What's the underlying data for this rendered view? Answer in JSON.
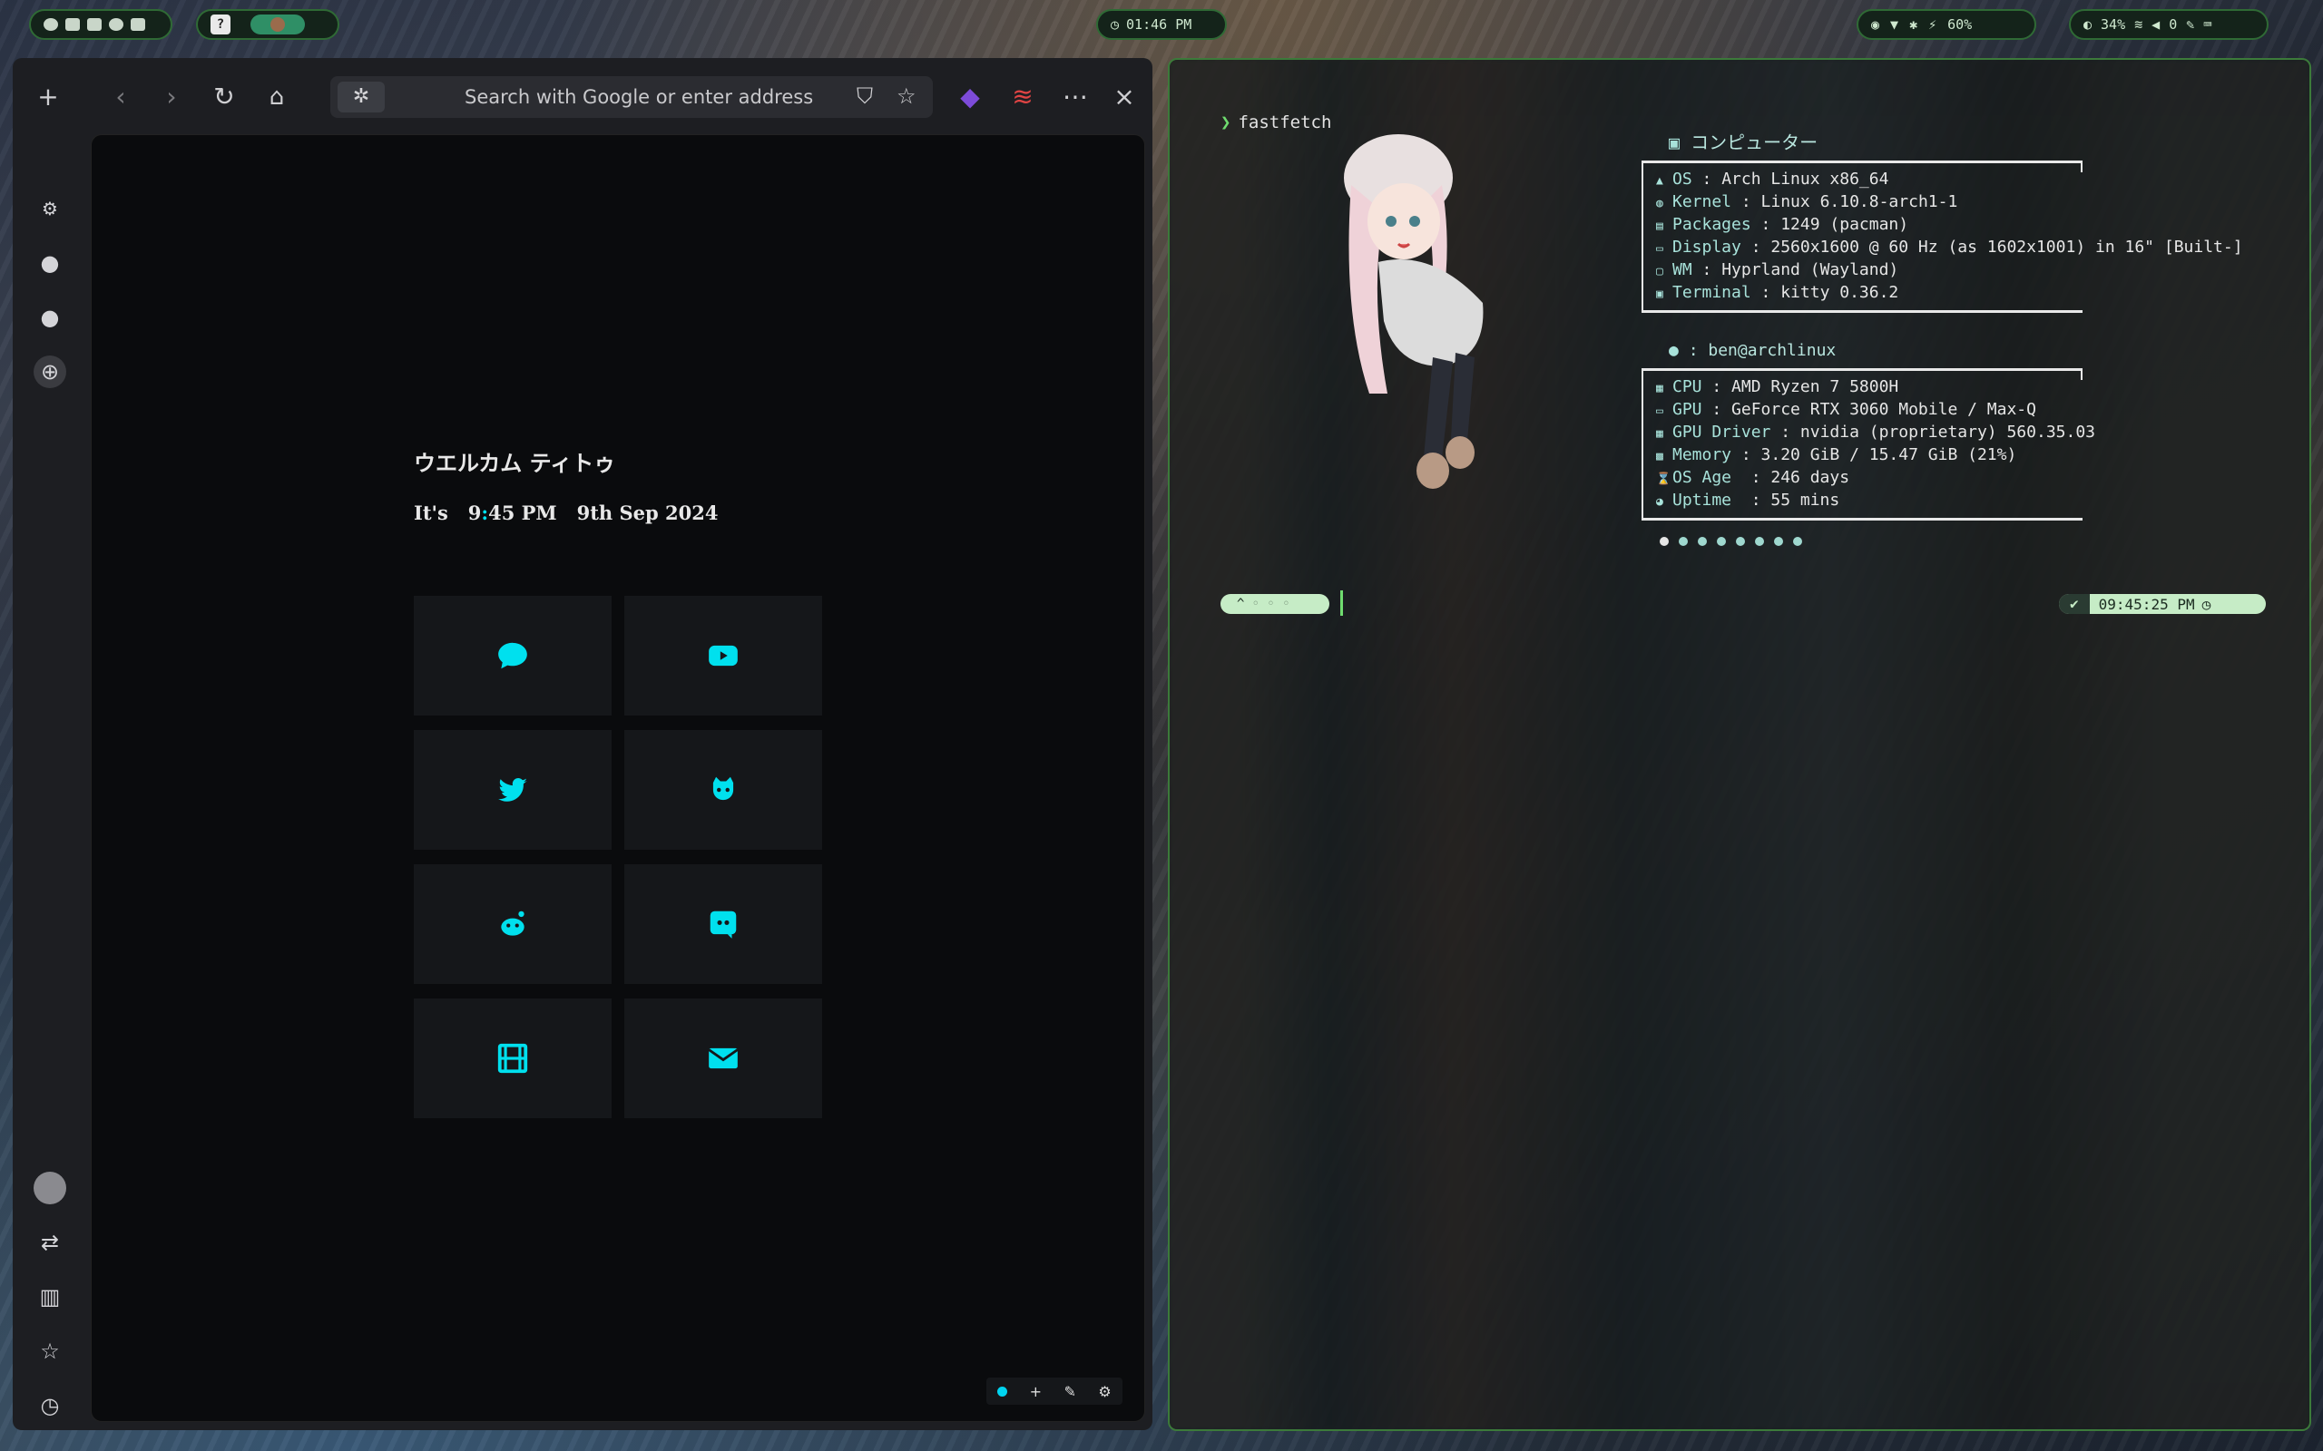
{
  "topbar": {
    "clock": "01:46 PM",
    "battery_left": "60%",
    "brightness": "34%",
    "volume": "0",
    "workspace_active_label": "",
    "workspace_button": "?"
  },
  "browser": {
    "address_placeholder": "Search with Google or enter address",
    "greeting": "ウエルカム ティトゥ",
    "time_prefix": "It's",
    "time_hour": "9",
    "time_colon": ":",
    "time_minute": "45 PM",
    "date": "9th Sep 2024",
    "tiles": [
      "chat-icon",
      "youtube-icon",
      "twitter-icon",
      "github-icon",
      "reddit-icon",
      "discord-icon",
      "film-icon",
      "mail-icon"
    ],
    "accent": "#00e0ee"
  },
  "terminal": {
    "command": "fastfetch",
    "header_host": "コンピューター",
    "system": [
      {
        "key": "OS",
        "value": "Arch Linux x86_64"
      },
      {
        "key": "Kernel",
        "value": "Linux 6.10.8-arch1-1"
      },
      {
        "key": "Packages",
        "value": "1249 (pacman)"
      },
      {
        "key": "Display",
        "value": "2560x1600 @ 60 Hz (as 1602x1001) in 16\" [Built-]"
      },
      {
        "key": "WM",
        "value": "Hyprland (Wayland)"
      },
      {
        "key": "Terminal",
        "value": "kitty 0.36.2"
      }
    ],
    "user_header": ": ben@archlinux",
    "hardware": [
      {
        "key": "CPU",
        "value": "AMD Ryzen 7 5800H"
      },
      {
        "key": "GPU",
        "value": "GeForce RTX 3060 Mobile / Max-Q"
      },
      {
        "key": "GPU Driver",
        "value": "nvidia (proprietary) 560.35.03"
      },
      {
        "key": "Memory",
        "value": "3.20 GiB / 15.47 GiB (21%)"
      },
      {
        "key": "OS Age ",
        "value": "246 days"
      },
      {
        "key": "Uptime ",
        "value": "55 mins"
      }
    ],
    "palette": [
      "#e6e6e6",
      "#9fd8cf",
      "#9fd8cf",
      "#9fd8cf",
      "#9fd8cf",
      "#9fd8cf",
      "#9fd8cf",
      "#9fd8cf"
    ],
    "prompt_time": "09:45:25 PM",
    "prompt_left": "^"
  }
}
